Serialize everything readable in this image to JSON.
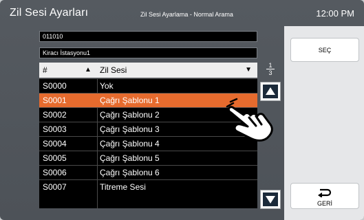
{
  "header": {
    "title": "Zil Sesi Ayarları",
    "subtitle": "Zil Sesi Ayarlama - Normal Arama",
    "clock": "12:00 PM"
  },
  "fields": {
    "code": "011010",
    "station": "Kiracı İstasyonu1"
  },
  "table": {
    "headers": [
      "#",
      "Zil Sesi"
    ],
    "rows": [
      {
        "code": "S0000",
        "name": "Yok"
      },
      {
        "code": "S0001",
        "name": "Çağrı Şablonu 1"
      },
      {
        "code": "S0002",
        "name": "Çağrı Şablonu 2"
      },
      {
        "code": "S0003",
        "name": "Çağrı Şablonu 3"
      },
      {
        "code": "S0004",
        "name": "Çağrı Şablonu 4"
      },
      {
        "code": "S0005",
        "name": "Çağrı Şablonu 5"
      },
      {
        "code": "S0006",
        "name": "Çağrı Şablonu 6"
      },
      {
        "code": "S0007",
        "name": "Titreme Sesi"
      }
    ],
    "selected_index": 1
  },
  "pagination": {
    "current": "1",
    "total": "3"
  },
  "buttons": {
    "select": "SEÇ",
    "back": "GERİ"
  },
  "icons": {
    "sort_asc": "up-triangle-icon",
    "sort_desc": "down-triangle-icon",
    "scroll_up": "up-arrow-icon",
    "scroll_down": "down-arrow-icon",
    "back": "back-arrow-icon",
    "pointer": "hand-pointer-icon"
  },
  "colors": {
    "selected_row": "#e66b2e",
    "background": "#555a60"
  }
}
